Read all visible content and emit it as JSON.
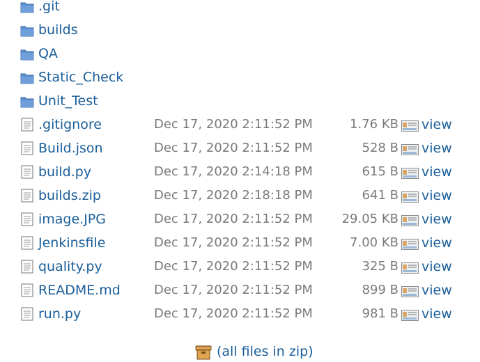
{
  "folders": [
    {
      "name": ".git",
      "icon": "folder-icon"
    },
    {
      "name": "builds",
      "icon": "folder-icon"
    },
    {
      "name": "QA",
      "icon": "folder-icon"
    },
    {
      "name": "Static_Check",
      "icon": "folder-icon"
    },
    {
      "name": "Unit_Test",
      "icon": "folder-icon"
    }
  ],
  "files": [
    {
      "name": ".gitignore",
      "date": "Dec 17, 2020 2:11:52 PM",
      "size": "1.76 KB",
      "view": "view",
      "icon": "file-icon"
    },
    {
      "name": "Build.json",
      "date": "Dec 17, 2020 2:11:52 PM",
      "size": "528 B",
      "view": "view",
      "icon": "file-icon"
    },
    {
      "name": "build.py",
      "date": "Dec 17, 2020 2:14:18 PM",
      "size": "615 B",
      "view": "view",
      "icon": "file-icon"
    },
    {
      "name": "builds.zip",
      "date": "Dec 17, 2020 2:18:18 PM",
      "size": "641 B",
      "view": "view",
      "icon": "file-icon"
    },
    {
      "name": "image.JPG",
      "date": "Dec 17, 2020 2:11:52 PM",
      "size": "29.05 KB",
      "view": "view",
      "icon": "file-icon"
    },
    {
      "name": "Jenkinsfile",
      "date": "Dec 17, 2020 2:11:52 PM",
      "size": "7.00 KB",
      "view": "view",
      "icon": "file-icon"
    },
    {
      "name": "quality.py",
      "date": "Dec 17, 2020 2:11:52 PM",
      "size": "325 B",
      "view": "view",
      "icon": "file-icon"
    },
    {
      "name": "README.md",
      "date": "Dec 17, 2020 2:11:52 PM",
      "size": "899 B",
      "view": "view",
      "icon": "file-icon"
    },
    {
      "name": "run.py",
      "date": "Dec 17, 2020 2:11:52 PM",
      "size": "981 B",
      "view": "view",
      "icon": "file-icon"
    }
  ],
  "zip": {
    "label": "(all files in zip)",
    "icon": "zip-archive-icon"
  },
  "colors": {
    "link": "#1a5e9a",
    "meta_text": "#7a7a7a",
    "folder": "#5b8fcf"
  }
}
